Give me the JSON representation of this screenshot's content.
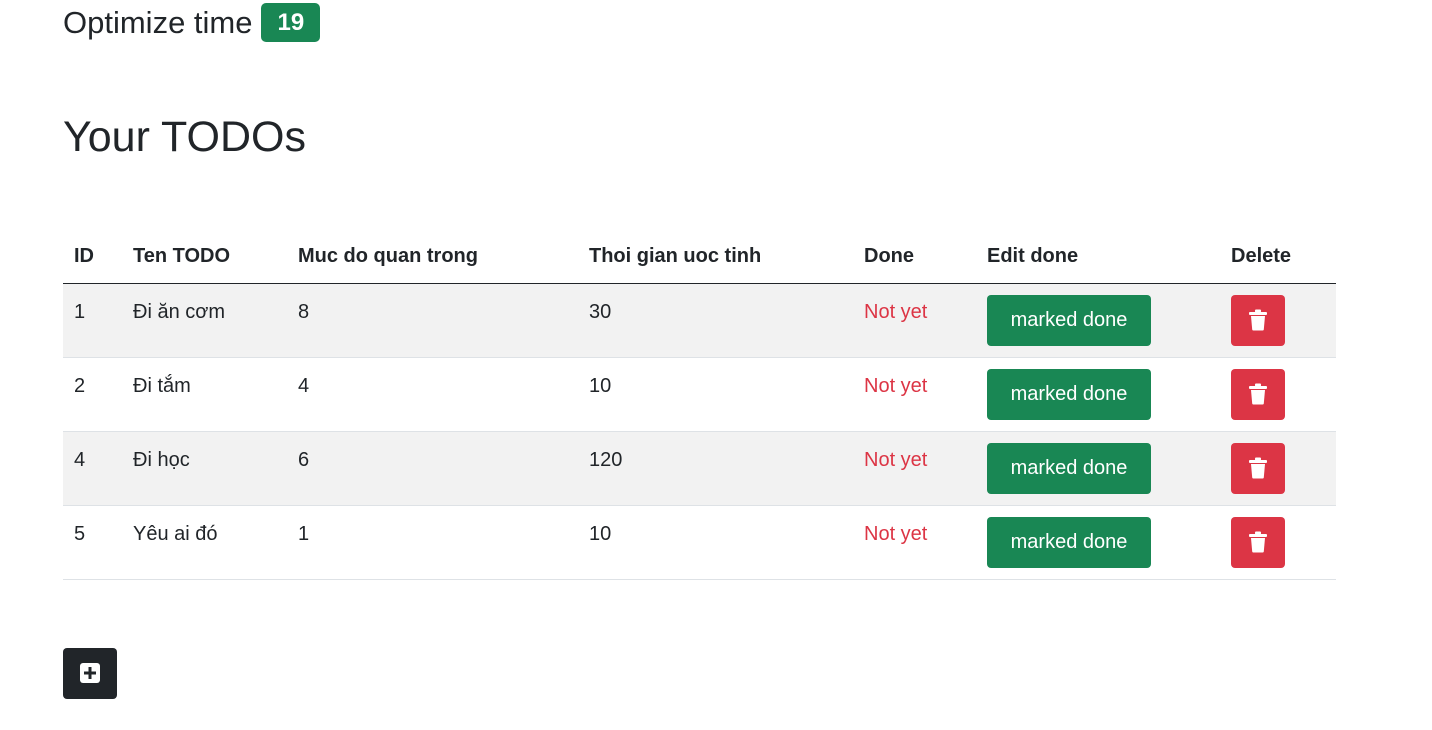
{
  "header": {
    "optimize_label": "Optimize time",
    "optimize_value": "19"
  },
  "title": "Your TODOs",
  "table": {
    "columns": [
      "ID",
      "Ten TODO",
      "Muc do quan trong",
      "Thoi gian uoc tinh",
      "Done",
      "Edit done",
      "Delete"
    ],
    "rows": [
      {
        "id": "1",
        "name": "Đi ăn cơm",
        "importance": "8",
        "time": "30",
        "status": "Not yet",
        "action": "marked done"
      },
      {
        "id": "2",
        "name": "Đi tắm",
        "importance": "4",
        "time": "10",
        "status": "Not yet",
        "action": "marked done"
      },
      {
        "id": "4",
        "name": "Đi học",
        "importance": "6",
        "time": "120",
        "status": "Not yet",
        "action": "marked done"
      },
      {
        "id": "5",
        "name": "Yêu ai đó",
        "importance": "1",
        "time": "10",
        "status": "Not yet",
        "action": "marked done"
      }
    ]
  },
  "icons": {
    "delete": "trash-icon",
    "add": "plus-square-icon"
  },
  "colors": {
    "success": "#198754",
    "danger": "#dc3545",
    "dark": "#212529",
    "stripe": "#f2f2f2"
  }
}
